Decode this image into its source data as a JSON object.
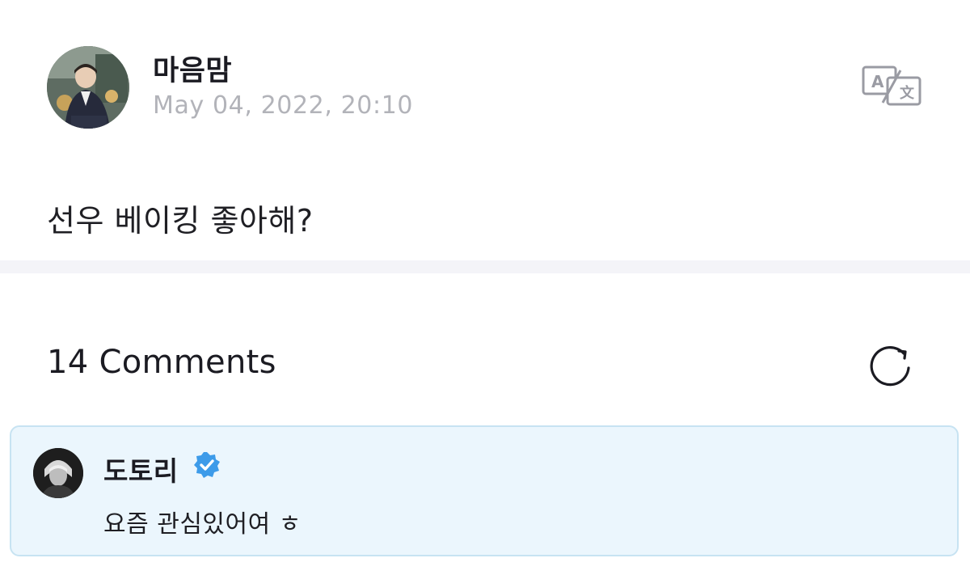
{
  "post": {
    "author": "마음맘",
    "timestamp": "May 04, 2022, 20:10",
    "avatar_icon": "user-photo-avatar",
    "translate_icon": "translate-icon",
    "body": "선우 베이킹 좋아해?"
  },
  "comments": {
    "count_label": "14 Comments",
    "refresh_icon": "refresh-icon",
    "items": [
      {
        "author": "도토리",
        "verified": true,
        "verified_icon": "verified-badge-icon",
        "text": "요즘 관심있어여 ㅎ"
      }
    ]
  },
  "colors": {
    "background": "#ffffff",
    "divider": "#f4f4f8",
    "timestamp": "#b2b3b9",
    "card_background": "#ebf6fd",
    "card_border": "#c7e3f2",
    "verified": "#3d9be9"
  }
}
